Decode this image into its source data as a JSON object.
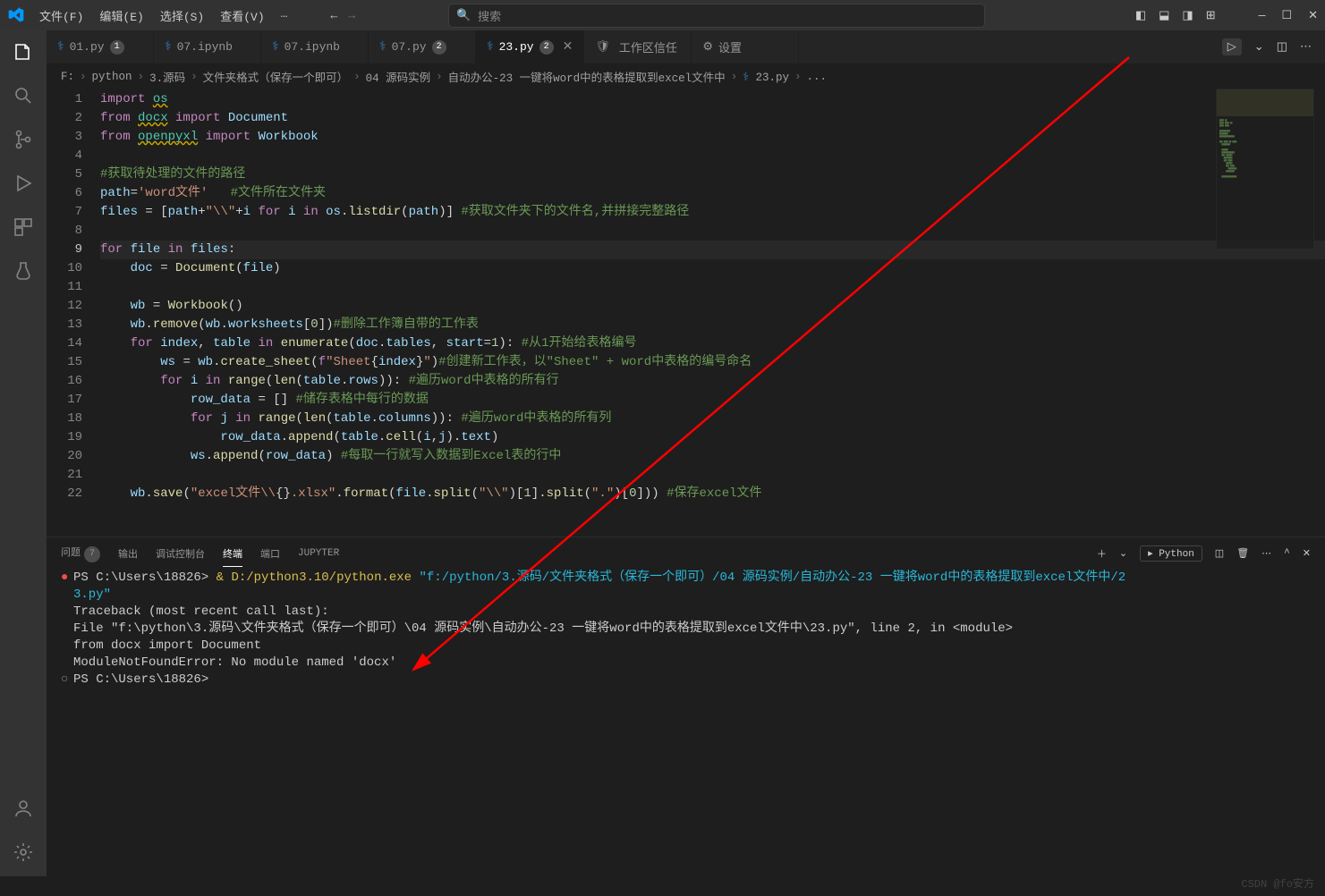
{
  "menubar": {
    "items": [
      "文件(F)",
      "编辑(E)",
      "选择(S)",
      "查看(V)",
      "…"
    ]
  },
  "search": {
    "placeholder": "搜索"
  },
  "tabs": [
    {
      "label": "01.py",
      "badge": "1",
      "icon": "python"
    },
    {
      "label": "07.ipynb",
      "icon": "python"
    },
    {
      "label": "07.ipynb",
      "icon": "python"
    },
    {
      "label": "07.py",
      "badge": "2",
      "icon": "python"
    },
    {
      "label": "23.py",
      "badge": "2",
      "icon": "python",
      "active": true
    },
    {
      "label": "工作区信任",
      "icon": "shield"
    },
    {
      "label": "设置",
      "icon": "settings"
    }
  ],
  "breadcrumbs": [
    "F:",
    "python",
    "3.源码",
    "文件夹格式（保存一个即可）",
    "04 源码实例",
    "自动办公-23 一键将word中的表格提取到excel文件中",
    "23.py",
    "..."
  ],
  "code": {
    "lines": [
      {
        "n": 1,
        "html": "<span class='tok-kw'>import</span> <span class='tok-mod underline'>os</span>"
      },
      {
        "n": 2,
        "html": "<span class='tok-kw'>from</span> <span class='tok-mod underline'>docx</span> <span class='tok-kw'>import</span> <span class='tok-var'>Document</span>"
      },
      {
        "n": 3,
        "html": "<span class='tok-kw'>from</span> <span class='tok-mod underline'>openpyxl</span> <span class='tok-kw'>import</span> <span class='tok-var'>Workbook</span>"
      },
      {
        "n": 4,
        "html": ""
      },
      {
        "n": 5,
        "html": "<span class='tok-com'>#获取待处理的文件的路径</span>"
      },
      {
        "n": 6,
        "html": "<span class='tok-var'>path</span><span class='tok-w'>=</span><span class='tok-str'>'word文件'</span>   <span class='tok-com'>#文件所在文件夹</span>"
      },
      {
        "n": 7,
        "html": "<span class='tok-var'>files</span> <span class='tok-w'>=</span> <span class='tok-w'>[</span><span class='tok-var'>path</span><span class='tok-w'>+</span><span class='tok-str'>\"\\\\\"</span><span class='tok-w'>+</span><span class='tok-var'>i</span> <span class='tok-kw'>for</span> <span class='tok-var'>i</span> <span class='tok-kw'>in</span> <span class='tok-var'>os</span><span class='tok-w'>.</span><span class='tok-fn'>listdir</span><span class='tok-w'>(</span><span class='tok-var'>path</span><span class='tok-w'>)]</span> <span class='tok-com'>#获取文件夹下的文件名,并拼接完整路径</span>"
      },
      {
        "n": 8,
        "html": ""
      },
      {
        "n": 9,
        "html": "<span class='tok-kw'>for</span> <span class='tok-var'>file</span> <span class='tok-kw'>in</span> <span class='tok-var'>files</span><span class='tok-w'>:</span>",
        "current": true
      },
      {
        "n": 10,
        "html": "    <span class='tok-var'>doc</span> <span class='tok-w'>=</span> <span class='tok-fn'>Document</span><span class='tok-w'>(</span><span class='tok-var'>file</span><span class='tok-w'>)</span>"
      },
      {
        "n": 11,
        "html": ""
      },
      {
        "n": 12,
        "html": "    <span class='tok-var'>wb</span> <span class='tok-w'>=</span> <span class='tok-fn'>Workbook</span><span class='tok-w'>()</span>"
      },
      {
        "n": 13,
        "html": "    <span class='tok-var'>wb</span><span class='tok-w'>.</span><span class='tok-fn'>remove</span><span class='tok-w'>(</span><span class='tok-var'>wb</span><span class='tok-w'>.</span><span class='tok-var'>worksheets</span><span class='tok-w'>[</span><span class='tok-num'>0</span><span class='tok-w'>])</span><span class='tok-com'>#删除工作簿自带的工作表</span>"
      },
      {
        "n": 14,
        "html": "    <span class='tok-kw'>for</span> <span class='tok-var'>index</span><span class='tok-w'>,</span> <span class='tok-var'>table</span> <span class='tok-kw'>in</span> <span class='tok-fn'>enumerate</span><span class='tok-w'>(</span><span class='tok-var'>doc</span><span class='tok-w'>.</span><span class='tok-var'>tables</span><span class='tok-w'>,</span> <span class='tok-var'>start</span><span class='tok-w'>=</span><span class='tok-num'>1</span><span class='tok-w'>):</span> <span class='tok-com'>#从1开始给表格编号</span>"
      },
      {
        "n": 15,
        "html": "        <span class='tok-var'>ws</span> <span class='tok-w'>=</span> <span class='tok-var'>wb</span><span class='tok-w'>.</span><span class='tok-fn'>create_sheet</span><span class='tok-w'>(</span><span class='tok-kw'>f</span><span class='tok-str'>\"Sheet</span><span class='tok-w'>{</span><span class='tok-var'>index</span><span class='tok-w'>}</span><span class='tok-str'>\"</span><span class='tok-w'>)</span><span class='tok-com'>#创建新工作表，以\"Sheet\" + word中表格的编号命名</span>"
      },
      {
        "n": 16,
        "html": "        <span class='tok-kw'>for</span> <span class='tok-var'>i</span> <span class='tok-kw'>in</span> <span class='tok-fn'>range</span><span class='tok-w'>(</span><span class='tok-fn'>len</span><span class='tok-w'>(</span><span class='tok-var'>table</span><span class='tok-w'>.</span><span class='tok-var'>rows</span><span class='tok-w'>)):</span> <span class='tok-com'>#遍历word中表格的所有行</span>"
      },
      {
        "n": 17,
        "html": "            <span class='tok-var'>row_data</span> <span class='tok-w'>=</span> <span class='tok-w'>[]</span> <span class='tok-com'>#储存表格中每行的数据</span>"
      },
      {
        "n": 18,
        "html": "            <span class='tok-kw'>for</span> <span class='tok-var'>j</span> <span class='tok-kw'>in</span> <span class='tok-fn'>range</span><span class='tok-w'>(</span><span class='tok-fn'>len</span><span class='tok-w'>(</span><span class='tok-var'>table</span><span class='tok-w'>.</span><span class='tok-var'>columns</span><span class='tok-w'>)):</span> <span class='tok-com'>#遍历word中表格的所有列</span>"
      },
      {
        "n": 19,
        "html": "                <span class='tok-var'>row_data</span><span class='tok-w'>.</span><span class='tok-fn'>append</span><span class='tok-w'>(</span><span class='tok-var'>table</span><span class='tok-w'>.</span><span class='tok-fn'>cell</span><span class='tok-w'>(</span><span class='tok-var'>i</span><span class='tok-w'>,</span><span class='tok-var'>j</span><span class='tok-w'>).</span><span class='tok-var'>text</span><span class='tok-w'>)</span>"
      },
      {
        "n": 20,
        "html": "            <span class='tok-var'>ws</span><span class='tok-w'>.</span><span class='tok-fn'>append</span><span class='tok-w'>(</span><span class='tok-var'>row_data</span><span class='tok-w'>)</span> <span class='tok-com'>#每取一行就写入数据到Excel表的行中</span>"
      },
      {
        "n": 21,
        "html": ""
      },
      {
        "n": 22,
        "html": "    <span class='tok-var'>wb</span><span class='tok-w'>.</span><span class='tok-fn'>save</span><span class='tok-w'>(</span><span class='tok-str'>\"excel文件\\\\</span><span class='tok-w'>{}</span><span class='tok-str'>.xlsx\"</span><span class='tok-w'>.</span><span class='tok-fn'>format</span><span class='tok-w'>(</span><span class='tok-var'>file</span><span class='tok-w'>.</span><span class='tok-fn'>split</span><span class='tok-w'>(</span><span class='tok-str'>\"\\\\\"</span><span class='tok-w'>)[</span><span class='tok-num'>1</span><span class='tok-w'>].</span><span class='tok-fn'>split</span><span class='tok-w'>(</span><span class='tok-str'>\".\"</span><span class='tok-w'>)[</span><span class='tok-num'>0</span><span class='tok-w'>]))</span> <span class='tok-com'>#保存excel文件</span>"
      }
    ]
  },
  "panel": {
    "tabs": {
      "problems": "问题",
      "problems_badge": "7",
      "output": "输出",
      "debug": "调试控制台",
      "terminal": "终端",
      "ports": "端口",
      "jupyter": "JUPYTER"
    },
    "terminal_type": "Python",
    "terminal_lines": [
      {
        "icon": "●",
        "icon_color": "term-red",
        "segs": [
          {
            "t": "PS C:\\Users\\18826> ",
            "c": ""
          },
          {
            "t": "& ",
            "c": "term-yellow"
          },
          {
            "t": "D:/python3.10/python.exe ",
            "c": "term-yellow"
          },
          {
            "t": "\"f:/python/3.源码/文件夹格式（保存一个即可）/04 源码实例/自动办公-23 一键将word中的表格提取到excel文件中/2",
            "c": "term-cyan"
          }
        ]
      },
      {
        "icon": "",
        "segs": [
          {
            "t": "3.py\"",
            "c": "term-cyan"
          }
        ]
      },
      {
        "icon": "",
        "segs": [
          {
            "t": "Traceback (most recent call last):",
            "c": ""
          }
        ]
      },
      {
        "icon": "",
        "segs": [
          {
            "t": "  File \"f:\\python\\3.源码\\文件夹格式（保存一个即可）\\04 源码实例\\自动办公-23 一键将word中的表格提取到excel文件中\\23.py\", line 2, in <module>",
            "c": ""
          }
        ]
      },
      {
        "icon": "",
        "segs": [
          {
            "t": "    from docx import Document",
            "c": ""
          }
        ]
      },
      {
        "icon": "",
        "segs": [
          {
            "t": "ModuleNotFoundError: No module named 'docx'",
            "c": ""
          }
        ]
      },
      {
        "icon": "○",
        "segs": [
          {
            "t": "PS C:\\Users\\18826> ",
            "c": ""
          }
        ]
      }
    ]
  },
  "watermark": "CSDN @fo安方"
}
